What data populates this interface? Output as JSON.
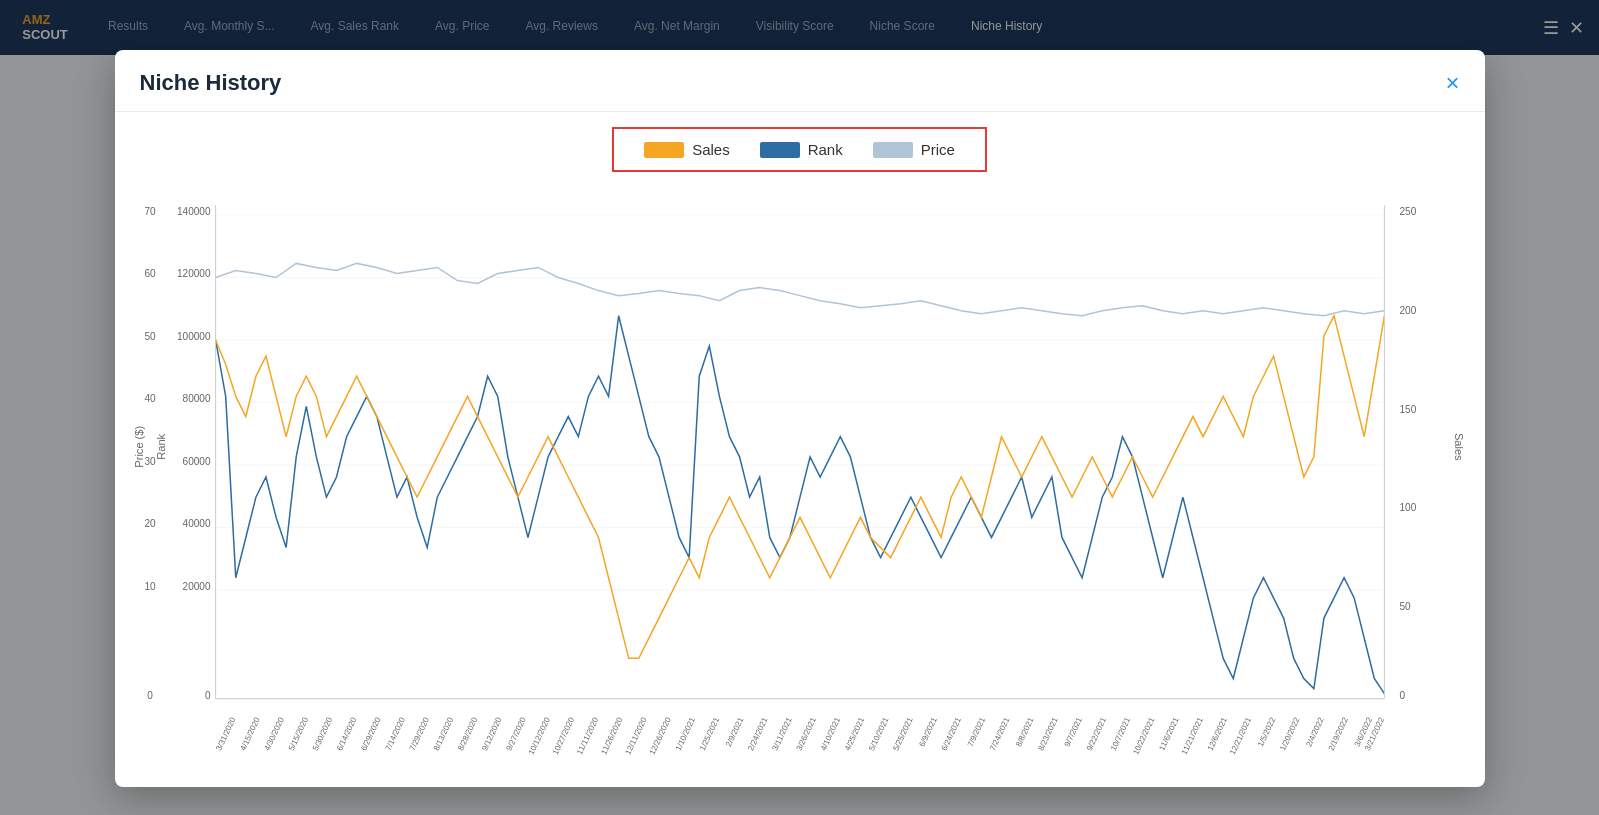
{
  "nav": {
    "logo": "AMZ\nSCOUT",
    "tabs": [
      {
        "label": "Results",
        "active": false
      },
      {
        "label": "Avg. Monthly S...",
        "active": false
      },
      {
        "label": "Avg. Sales Rank",
        "active": false
      },
      {
        "label": "Avg. Price",
        "active": false
      },
      {
        "label": "Avg. Reviews",
        "active": false
      },
      {
        "label": "Avg. Net Margin",
        "active": false
      },
      {
        "label": "Visibility Score",
        "active": false
      },
      {
        "label": "Niche Score",
        "active": false
      },
      {
        "label": "Niche History",
        "active": true
      }
    ]
  },
  "modal": {
    "title": "Niche History",
    "close_label": "×"
  },
  "legend": {
    "sales_label": "Sales",
    "rank_label": "Rank",
    "price_label": "Price"
  },
  "chart": {
    "left_axis_label": "Price ($)",
    "rank_axis_label": "Rank",
    "right_axis_label": "Sales",
    "left_y_values": [
      "70",
      "60",
      "50",
      "40",
      "30",
      "20",
      "10",
      "0"
    ],
    "rank_y_values": [
      "140000",
      "120000",
      "100000",
      "80000",
      "60000",
      "40000",
      "20000",
      "0"
    ],
    "right_y_values": [
      "250",
      "200",
      "150",
      "100",
      "50",
      "0"
    ],
    "x_labels": [
      "3/31/2020",
      "4/15/2020",
      "4/30/2020",
      "5/15/2020",
      "5/30/2020",
      "6/14/2020",
      "6/29/2020",
      "7/14/2020",
      "7/29/2020",
      "8/13/2020",
      "8/28/2020",
      "9/12/2020",
      "9/27/2020",
      "10/12/2020",
      "10/27/2020",
      "11/11/2020",
      "11/26/2020",
      "12/11/2020",
      "12/26/2020",
      "1/10/2021",
      "1/25/2021",
      "2/9/2021",
      "2/24/2021",
      "3/11/2021",
      "3/26/2021",
      "4/10/2021",
      "4/25/2021",
      "5/10/2021",
      "5/25/2021",
      "6/9/2021",
      "6/24/2021",
      "7/9/2021",
      "7/24/2021",
      "8/8/2021",
      "8/23/2021",
      "9/7/2021",
      "9/22/2021",
      "10/7/2021",
      "10/22/2021",
      "11/6/2021",
      "11/21/2021",
      "12/6/2021",
      "12/21/2021",
      "1/5/2022",
      "1/20/2022",
      "2/4/2022",
      "2/19/2022",
      "3/6/2022",
      "3/21/2022"
    ]
  }
}
